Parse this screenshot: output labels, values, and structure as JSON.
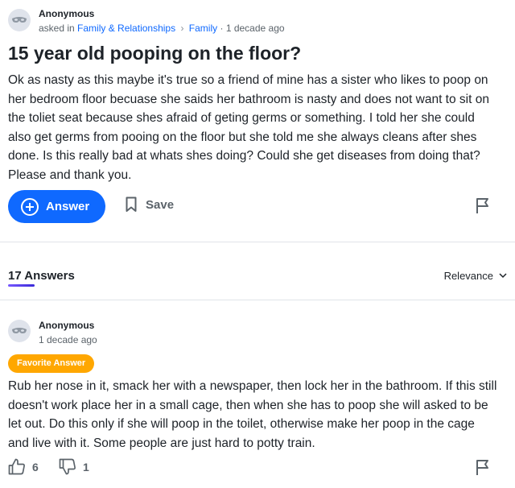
{
  "question": {
    "author": "Anonymous",
    "asked_prefix": "asked in",
    "category": "Family & Relationships",
    "subcategory": "Family",
    "time": "1 decade ago",
    "title": "15 year old pooping on the floor?",
    "body_lines": [
      "Ok as nasty as this maybe it's true so a friend of mine has a sister who likes to poop on",
      "her bedroom floor becuase she saids her bathroom is nasty and does not want to sit on",
      "the toliet seat because shes afraid of geting germs or something. I told her she could",
      "also get germs from pooing on the floor but she told me she always cleans after shes",
      "done. Is this really bad at whats shes doing? Could she get diseases from doing that?",
      "Please and thank you."
    ],
    "answer_label": "Answer",
    "save_label": "Save"
  },
  "answers_header": {
    "count_label": "17 Answers",
    "sort_label": "Relevance"
  },
  "answer": {
    "author": "Anonymous",
    "time": "1 decade ago",
    "badge": "Favorite Answer",
    "body_lines": [
      "Rub her nose in it, smack her with a newspaper, then lock her in the bathroom. If this still",
      "doesn't work place her in a small cage, then when she has to poop she will asked to be",
      "let out. Do this only if she will poop in the toilet, otherwise make her poop in the cage",
      "and live with it. Some people are just hard to potty train."
    ],
    "thumbs_up": "6",
    "thumbs_down": "1"
  },
  "colors": {
    "accent": "#0f69ff",
    "badge": "#ffa700",
    "underline": "#6a4cff"
  },
  "icons": [
    "anonymous-mask-icon",
    "plus-circle-icon",
    "bookmark-icon",
    "flag-icon",
    "chevron-down-icon",
    "thumbs-up-icon",
    "thumbs-down-icon",
    "chevron-right-icon"
  ]
}
